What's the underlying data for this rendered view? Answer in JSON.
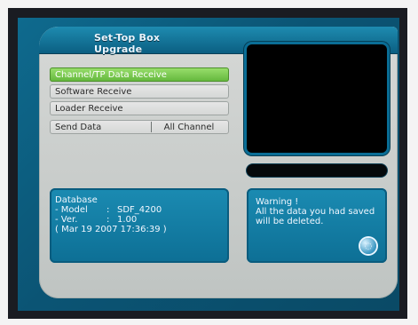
{
  "window": {
    "title": "Set-Top Box Upgrade"
  },
  "menu": {
    "items": [
      {
        "label": "Channel/TP Data Receive",
        "selected": true
      },
      {
        "label": "Software Receive",
        "selected": false
      },
      {
        "label": "Loader Receive",
        "selected": false
      }
    ],
    "send_data": {
      "label": "Send Data",
      "value": "All Channel"
    }
  },
  "database": {
    "heading": "Database",
    "model_label": "- Model",
    "model_value": "SDF_4200",
    "version_label": "- Ver.",
    "version_value": "1.00",
    "build_datetime": "( Mar 19 2007  17:36:39 )"
  },
  "warning": {
    "title": "Warning !",
    "message": "All the data you had saved will be deleted."
  },
  "icons": {
    "globe": "globe-icon"
  },
  "colors": {
    "selected": "#62b63b",
    "panel_accent": "#0d6f95",
    "preview": "#000000"
  }
}
